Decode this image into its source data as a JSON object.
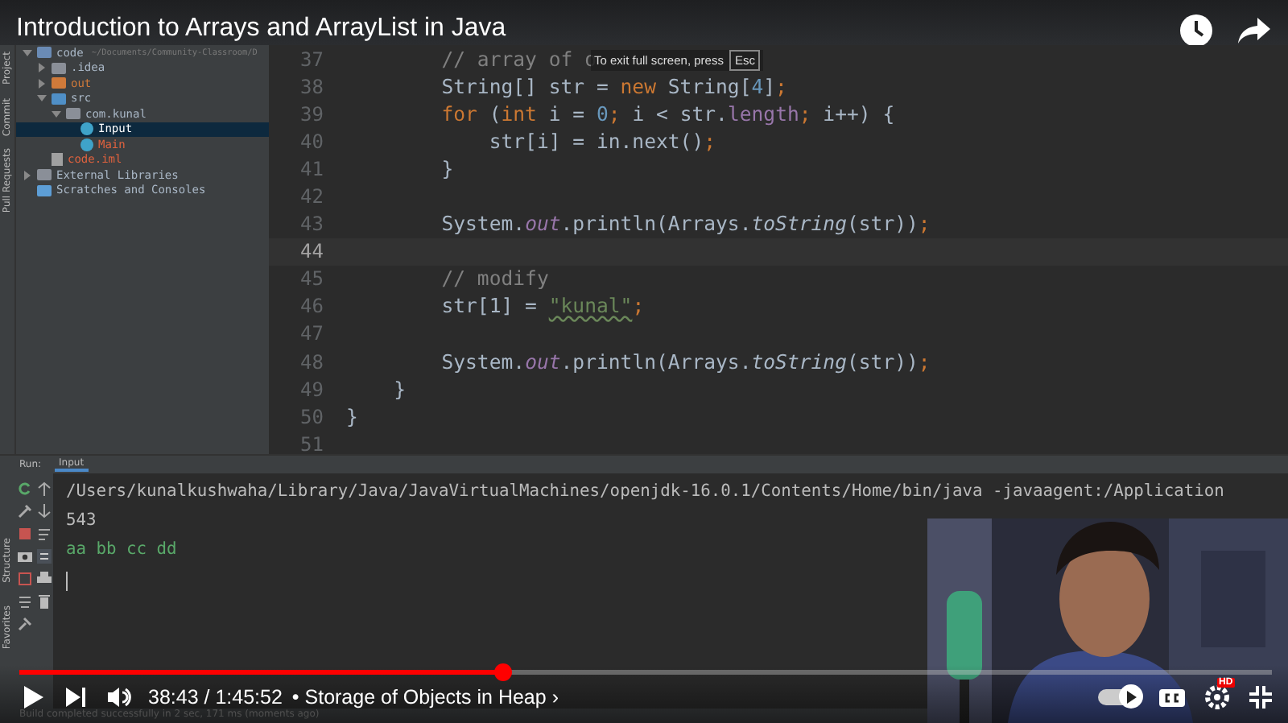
{
  "video_title": "Introduction to Arrays and ArrayList in Java",
  "side_tabs_top": [
    "Project",
    "Commit",
    "Pull Requests"
  ],
  "side_tabs_bottom": [
    "Structure",
    "Favorites"
  ],
  "tree": [
    {
      "label": "code",
      "kind": "module",
      "path": "~/Documents/Community-Classroom/D",
      "expanded": true,
      "selected": false,
      "excluded": false,
      "unversioned": false,
      "children": [
        {
          "label": ".idea",
          "kind": "folder",
          "expanded": false,
          "selected": false,
          "excluded": false,
          "unversioned": false
        },
        {
          "label": "out",
          "kind": "excluded",
          "expanded": false,
          "selected": false,
          "excluded": true,
          "unversioned": false
        },
        {
          "label": "src",
          "kind": "source",
          "expanded": true,
          "selected": false,
          "excluded": false,
          "unversioned": false,
          "children": [
            {
              "label": "com.kunal",
              "kind": "package",
              "expanded": true,
              "selected": false,
              "excluded": false,
              "unversioned": false,
              "children": [
                {
                  "label": "Input",
                  "kind": "class",
                  "selected": true,
                  "excluded": false,
                  "unversioned": false
                },
                {
                  "label": "Main",
                  "kind": "class",
                  "selected": false,
                  "excluded": false,
                  "unversioned": true
                }
              ]
            }
          ]
        },
        {
          "label": "code.iml",
          "kind": "file",
          "selected": false,
          "excluded": false,
          "unversioned": true
        }
      ]
    },
    {
      "label": "External Libraries",
      "kind": "library",
      "expanded": false,
      "selected": false,
      "excluded": false,
      "unversioned": false
    },
    {
      "label": "Scratches and Consoles",
      "kind": "scratch",
      "selected": false,
      "excluded": false,
      "unversioned": false
    }
  ],
  "code": [
    {
      "number": "37",
      "current": false,
      "tokens": [
        {
          "text": "        // array of o",
          "kind": "comment"
        }
      ]
    },
    {
      "number": "38",
      "current": false,
      "tokens": [
        {
          "text": "        String[] str = ",
          "kind": "plain"
        },
        {
          "text": "new",
          "kind": "keyword"
        },
        {
          "text": " String[",
          "kind": "plain"
        },
        {
          "text": "4",
          "kind": "number"
        },
        {
          "text": "]",
          "kind": "plain"
        },
        {
          "text": ";",
          "kind": "keyword"
        }
      ]
    },
    {
      "number": "39",
      "current": false,
      "tokens": [
        {
          "text": "        for",
          "kind": "keyword"
        },
        {
          "text": " (",
          "kind": "plain"
        },
        {
          "text": "int",
          "kind": "keyword"
        },
        {
          "text": " i = ",
          "kind": "plain"
        },
        {
          "text": "0",
          "kind": "number"
        },
        {
          "text": ";",
          "kind": "keyword"
        },
        {
          "text": " i < str.",
          "kind": "plain"
        },
        {
          "text": "length",
          "kind": "field"
        },
        {
          "text": ";",
          "kind": "keyword"
        },
        {
          "text": " i++) {",
          "kind": "plain"
        }
      ]
    },
    {
      "number": "40",
      "current": false,
      "tokens": [
        {
          "text": "            str[i] = in.next()",
          "kind": "plain"
        },
        {
          "text": ";",
          "kind": "keyword"
        }
      ]
    },
    {
      "number": "41",
      "current": false,
      "tokens": [
        {
          "text": "        }",
          "kind": "plain"
        }
      ]
    },
    {
      "number": "42",
      "current": false
    },
    {
      "number": "43",
      "current": false,
      "tokens": [
        {
          "text": "        System.",
          "kind": "plain"
        },
        {
          "text": "out",
          "kind": "static"
        },
        {
          "text": ".println(Arrays.",
          "kind": "plain"
        },
        {
          "text": "toString",
          "kind": "italic"
        },
        {
          "text": "(str))",
          "kind": "plain"
        },
        {
          "text": ";",
          "kind": "keyword"
        }
      ]
    },
    {
      "number": "44",
      "current": true
    },
    {
      "number": "45",
      "current": false,
      "tokens": [
        {
          "text": "        // modify",
          "kind": "comment"
        }
      ]
    },
    {
      "number": "46",
      "current": false,
      "tokens": [
        {
          "text": "        str[1] = ",
          "kind": "plain"
        },
        {
          "text": "\"kunal\"",
          "kind": "string"
        },
        {
          "text": ";",
          "kind": "keyword"
        }
      ]
    },
    {
      "number": "47",
      "current": false
    },
    {
      "number": "48",
      "current": false,
      "tokens": [
        {
          "text": "        System.",
          "kind": "plain"
        },
        {
          "text": "out",
          "kind": "static"
        },
        {
          "text": ".println(Arrays.",
          "kind": "plain"
        },
        {
          "text": "toString",
          "kind": "italic"
        },
        {
          "text": "(str))",
          "kind": "plain"
        },
        {
          "text": ";",
          "kind": "keyword"
        }
      ]
    },
    {
      "number": "49",
      "current": false,
      "tokens": [
        {
          "text": "    }",
          "kind": "plain"
        }
      ]
    },
    {
      "number": "50",
      "current": false,
      "tokens": [
        {
          "text": "}",
          "kind": "plain"
        }
      ]
    },
    {
      "number": "51",
      "current": false
    }
  ],
  "fullscreen_hint": {
    "text": "To exit full screen, press",
    "key": "Esc"
  },
  "run_panel": {
    "label": "Run:",
    "tab": "Input",
    "console": [
      {
        "text": "/Users/kunalkushwaha/Library/Java/JavaVirtualMachines/openjdk-16.0.1/Contents/Home/bin/java -javaagent:/Application",
        "kind": "output"
      },
      {
        "text": "543",
        "kind": "output"
      },
      {
        "text": "aa bb cc dd",
        "kind": "input"
      }
    ]
  },
  "status_bar": "Build completed successfully in 2 sec, 171 ms (moments ago)",
  "player": {
    "level": 0.385,
    "time": "38:43 / 1:45:52",
    "chapter": "• Storage of Objects in Heap ›",
    "hd_badge": "HD",
    "autoplay_on": true
  }
}
